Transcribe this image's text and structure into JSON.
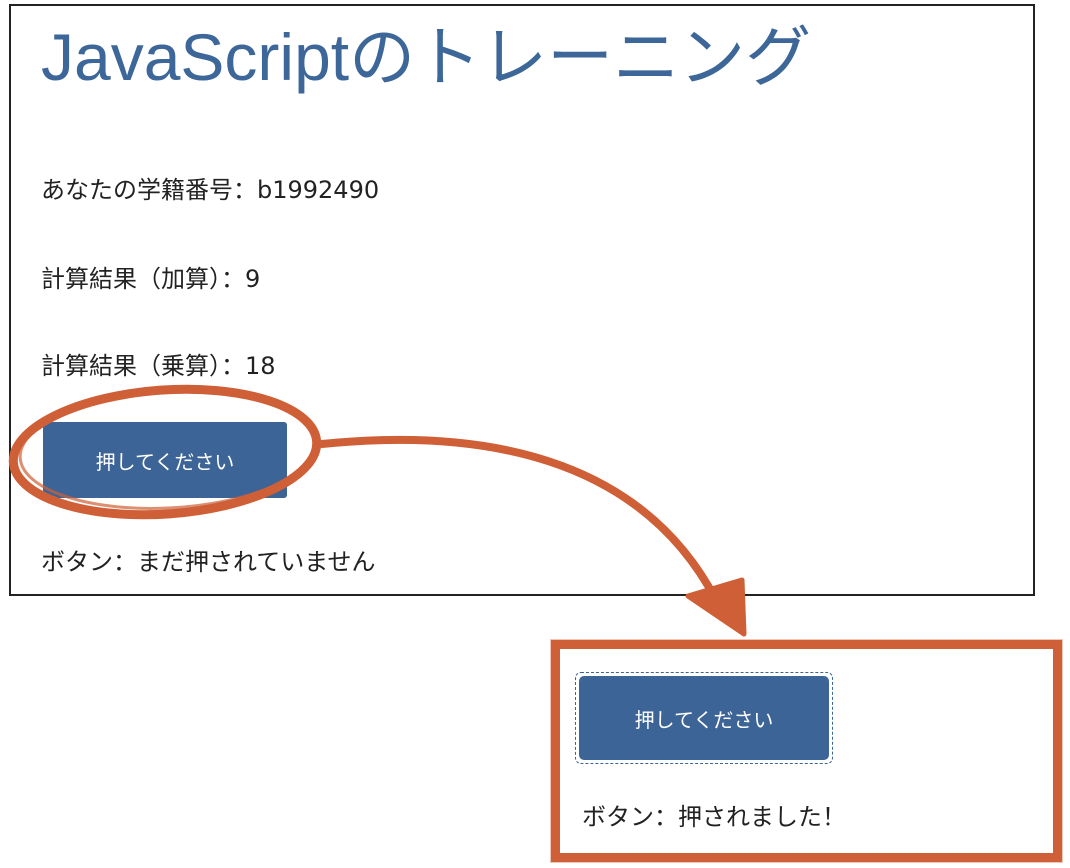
{
  "page": {
    "title": "JavaScriptのトレーニング",
    "student_id_line": "あなたの学籍番号：b1992490",
    "addition_result_line": "計算結果（加算）：9",
    "multiplication_result_line": "計算結果（乗算）：18",
    "button_label": "押してください",
    "button_status_line": "ボタン：まだ押されていません"
  },
  "inset": {
    "button_label": "押してください",
    "button_status_line": "ボタン：押されました！"
  },
  "colors": {
    "title": "#3d6799",
    "button_bg": "#3d6496",
    "annotation": "#cf5f36"
  },
  "icons": {
    "arrow": "curved-arrow-icon",
    "circle": "highlight-ellipse-icon"
  }
}
